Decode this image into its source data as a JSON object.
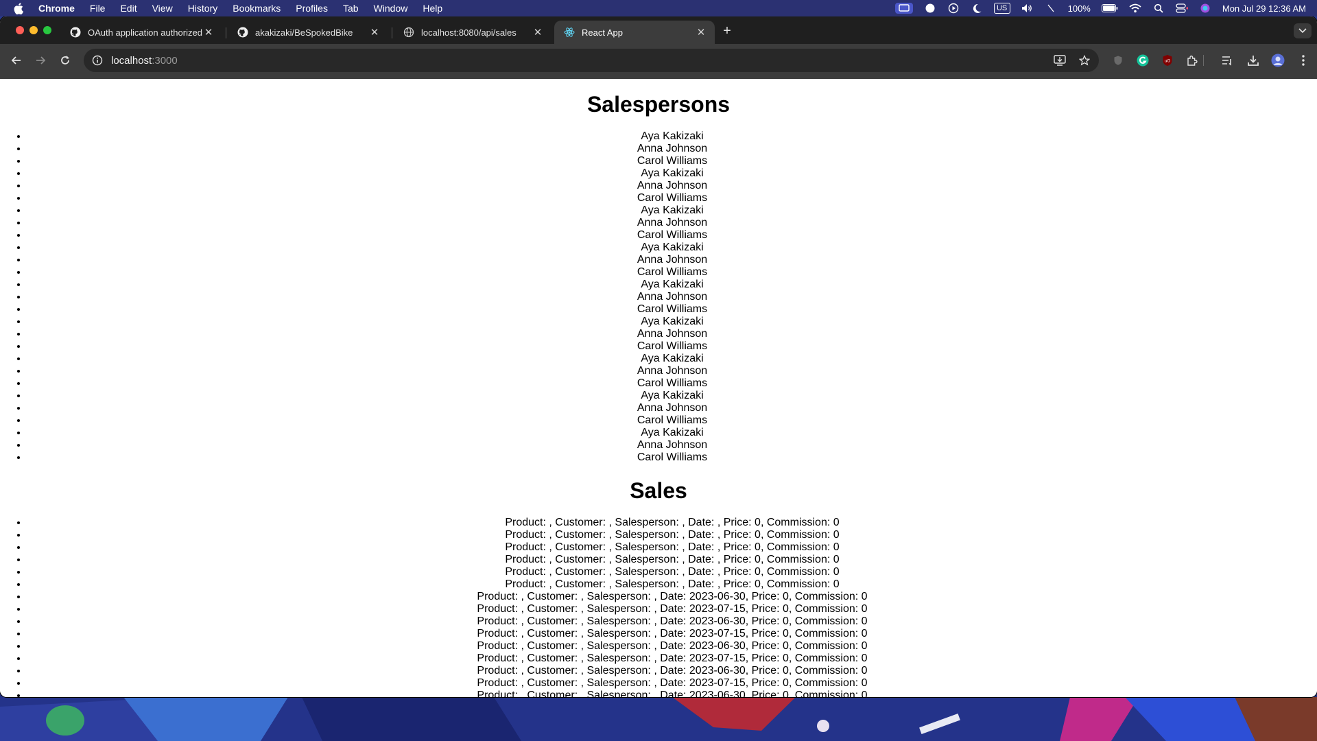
{
  "menubar": {
    "app_name": "Chrome",
    "items": [
      "File",
      "Edit",
      "View",
      "History",
      "Bookmarks",
      "Profiles",
      "Tab",
      "Window",
      "Help"
    ],
    "battery": "100%",
    "keyboard": "US",
    "clock": "Mon Jul 29  12:36 AM"
  },
  "browser": {
    "tabs": [
      {
        "title": "OAuth application authorized",
        "icon": "github-icon",
        "active": false
      },
      {
        "title": "akakizaki/BeSpokedBike",
        "icon": "github-icon",
        "active": false
      },
      {
        "title": "localhost:8080/api/sales",
        "icon": "globe-icon",
        "active": false
      },
      {
        "title": "React App",
        "icon": "react-icon",
        "active": true
      }
    ],
    "url_host": "localhost",
    "url_port": ":3000"
  },
  "page": {
    "salespersons_title": "Salespersons",
    "salespersons": [
      "Aya Kakizaki",
      "Anna Johnson",
      "Carol Williams",
      "Aya Kakizaki",
      "Anna Johnson",
      "Carol Williams",
      "Aya Kakizaki",
      "Anna Johnson",
      "Carol Williams",
      "Aya Kakizaki",
      "Anna Johnson",
      "Carol Williams",
      "Aya Kakizaki",
      "Anna Johnson",
      "Carol Williams",
      "Aya Kakizaki",
      "Anna Johnson",
      "Carol Williams",
      "Aya Kakizaki",
      "Anna Johnson",
      "Carol Williams",
      "Aya Kakizaki",
      "Anna Johnson",
      "Carol Williams",
      "Aya Kakizaki",
      "Anna Johnson",
      "Carol Williams"
    ],
    "sales_title": "Sales",
    "sales": [
      "Product: , Customer: , Salesperson: , Date: , Price: 0, Commission: 0",
      "Product: , Customer: , Salesperson: , Date: , Price: 0, Commission: 0",
      "Product: , Customer: , Salesperson: , Date: , Price: 0, Commission: 0",
      "Product: , Customer: , Salesperson: , Date: , Price: 0, Commission: 0",
      "Product: , Customer: , Salesperson: , Date: , Price: 0, Commission: 0",
      "Product: , Customer: , Salesperson: , Date: , Price: 0, Commission: 0",
      "Product: , Customer: , Salesperson: , Date: 2023-06-30, Price: 0, Commission: 0",
      "Product: , Customer: , Salesperson: , Date: 2023-07-15, Price: 0, Commission: 0",
      "Product: , Customer: , Salesperson: , Date: 2023-06-30, Price: 0, Commission: 0",
      "Product: , Customer: , Salesperson: , Date: 2023-07-15, Price: 0, Commission: 0",
      "Product: , Customer: , Salesperson: , Date: 2023-06-30, Price: 0, Commission: 0",
      "Product: , Customer: , Salesperson: , Date: 2023-07-15, Price: 0, Commission: 0",
      "Product: , Customer: , Salesperson: , Date: 2023-06-30, Price: 0, Commission: 0",
      "Product: , Customer: , Salesperson: , Date: 2023-07-15, Price: 0, Commission: 0",
      "Product: , Customer: , Salesperson: , Date: 2023-06-30, Price: 0, Commission: 0"
    ]
  },
  "colors": {
    "tab_strip": "#1f1f1f",
    "toolbar": "#3c3c3c",
    "menubar": "#2b3172"
  }
}
